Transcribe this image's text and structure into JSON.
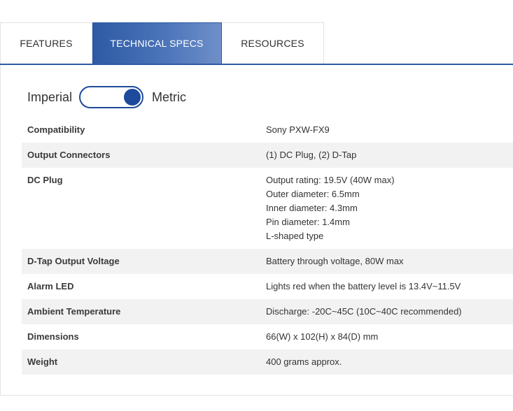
{
  "tabs": [
    {
      "label": "FEATURES",
      "active": false
    },
    {
      "label": "TECHNICAL SPECS",
      "active": true
    },
    {
      "label": "RESOURCES",
      "active": false
    }
  ],
  "units": {
    "left_label": "Imperial",
    "right_label": "Metric",
    "selected": "Metric"
  },
  "specs": [
    {
      "name": "Compatibility",
      "value": [
        "Sony PXW-FX9"
      ]
    },
    {
      "name": "Output Connectors",
      "value": [
        "(1) DC Plug, (2) D-Tap"
      ]
    },
    {
      "name": "DC Plug",
      "value": [
        "Output rating: 19.5V (40W max)",
        "Outer diameter: 6.5mm",
        "Inner diameter: 4.3mm",
        "Pin diameter: 1.4mm",
        "L-shaped type"
      ]
    },
    {
      "name": "D-Tap Output Voltage",
      "value": [
        "Battery through voltage, 80W max"
      ]
    },
    {
      "name": "Alarm LED",
      "value": [
        "Lights red when the battery level is 13.4V~11.5V"
      ]
    },
    {
      "name": "Ambient Temperature",
      "value": [
        "Discharge: -20C~45C (10C~40C recommended)"
      ]
    },
    {
      "name": "Dimensions",
      "value": [
        " 66(W) x 102(H) x 84(D) mm"
      ]
    },
    {
      "name": "Weight",
      "value": [
        "400 grams approx."
      ]
    }
  ],
  "colors": {
    "accent": "#2d5aa4",
    "row_stripe": "#f2f2f2"
  }
}
